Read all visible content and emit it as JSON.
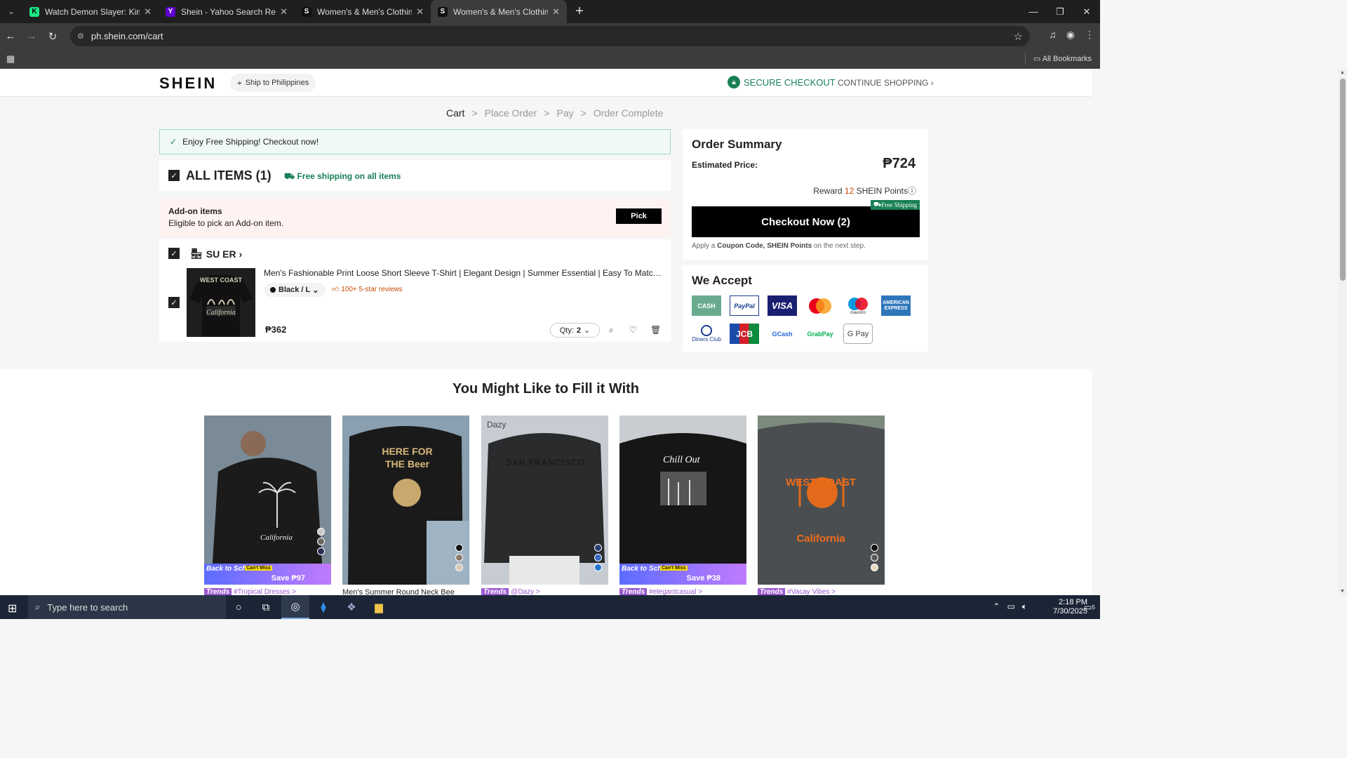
{
  "browser": {
    "tabs": [
      {
        "title": "Watch Demon Slayer: Kimetsu no",
        "favicon": "K",
        "color": "#1ce783"
      },
      {
        "title": "Shein - Yahoo Search Results",
        "favicon": "Y",
        "color": "#6001d2"
      },
      {
        "title": "Women's & Men's Clothing, Sh",
        "favicon": "S",
        "color": "#111111"
      },
      {
        "title": "Women's & Men's Clothing, Sh",
        "favicon": "S",
        "color": "#111111"
      }
    ],
    "url": "ph.shein.com/cart",
    "bookmarks_label": "All Bookmarks"
  },
  "header": {
    "logo": "SHEIN",
    "ship_to": "Ship to Philippines",
    "secure_checkout": "SECURE CHECKOUT",
    "continue_shopping": "CONTINUE SHOPPING"
  },
  "steps": [
    "Cart",
    "Place Order",
    "Pay",
    "Order Complete"
  ],
  "banner": "Enjoy Free Shipping! Checkout now!",
  "cart": {
    "all_items": "ALL ITEMS (1)",
    "free_shipping": "Free shipping on all items",
    "addon_title": "Add-on items",
    "addon_sub": "Eligible to pick an Add-on item.",
    "pick": "Pick",
    "store": "SU ER",
    "item": {
      "title": "Men's Fashionable Print Loose Short Sleeve T-Shirt | Elegant Design | Summer Essential | Easy To Match, S...",
      "variant": "Black / L",
      "reviews": "100+ 5-star reviews",
      "price": "₱362",
      "qty_label": "Qty:",
      "qty": "2",
      "print_text": "WEST COAST",
      "print_sub": "California"
    }
  },
  "summary": {
    "title": "Order Summary",
    "estimated_label": "Estimated Price:",
    "estimated_value": "₱724",
    "reward_prefix": "Reward",
    "reward_points": "12",
    "reward_suffix": "SHEIN Points",
    "free_shipping_tag": "Free Shipping",
    "checkout": "Checkout Now (2)",
    "note_a": "Apply a",
    "note_b": "Coupon Code, SHEIN Points",
    "note_c": "on the next step."
  },
  "accept": {
    "title": "We Accept",
    "methods": [
      "CASH",
      "PayPal",
      "VISA",
      "",
      "maestro",
      "AMERICAN EXPRESS",
      "Diners Club",
      "JCB",
      "GCash",
      "GrabPay",
      "G Pay"
    ]
  },
  "recommend": {
    "title": "You Might Like to Fill it With",
    "cards": [
      {
        "promo": "Save ₱97",
        "label": "",
        "trend": "#Tropical Dresses >",
        "print": "California",
        "bg": "#3a3f48"
      },
      {
        "promo": "",
        "label": "Men's Summer Round Neck Bee",
        "trend": "",
        "print": "HERE FOR THE Beer",
        "bg": "#2b2622"
      },
      {
        "promo": "",
        "label": "",
        "trend": "@Dazy >",
        "print": "SAN FRANCISCO",
        "bg": "#3b3d40",
        "brand": "Dazy"
      },
      {
        "promo": "Save ₱38",
        "label": "",
        "trend": "#elegantcasual >",
        "print": "Chill Out",
        "bg": "#1e1e1e"
      },
      {
        "promo": "",
        "label": "",
        "trend": "#Vacay Vibes >",
        "print": "WEST COAST California",
        "bg": "#55585a"
      }
    ],
    "back_school": "Back to School",
    "cant_miss": "Can't Miss",
    "trends": "Trends"
  },
  "taskbar": {
    "search": "Type here to search",
    "time": "2:18 PM",
    "date": "7/30/2025",
    "notifications": "5"
  }
}
